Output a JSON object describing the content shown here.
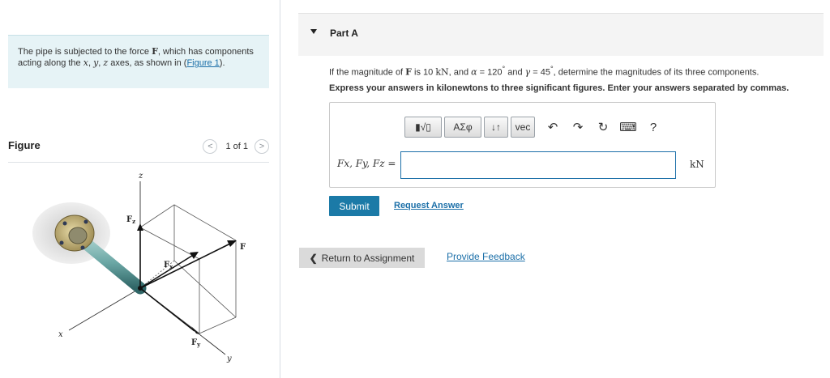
{
  "problem": {
    "text_before_F": "The pipe is subjected to the force ",
    "force_symbol": "F",
    "text_mid_1": ", which has components acting along the ",
    "axis_x": "x",
    "sep_1": ", ",
    "axis_y": "y",
    "sep_2": ", ",
    "axis_z": "z",
    "text_mid_2": " axes, as shown in (",
    "figure_link": "Figure 1",
    "text_end": ")."
  },
  "figure": {
    "title": "Figure",
    "pager_text": "1 of 1",
    "prev_icon": "chevron-left-icon",
    "next_icon": "chevron-right-icon",
    "labels": {
      "z": "z",
      "x": "x",
      "y": "y",
      "Fz": "F",
      "Fz_sub": "z",
      "Fx": "F",
      "Fx_sub": "x",
      "Fy": "F",
      "Fy_sub": "y",
      "F": "F"
    }
  },
  "part": {
    "title": "Part A",
    "caret_icon": "caret-down-icon",
    "q1": {
      "t1": "If the magnitude of ",
      "F": "F",
      "t2": " is 10 ",
      "unit": "kN",
      "t3": ", and ",
      "alpha": "α",
      "t4": " = 120",
      "deg1": "°",
      "t5": " and ",
      "gamma": "γ",
      "t6": " = 45",
      "deg2": "°",
      "t7": ", determine the magnitudes of its three components."
    },
    "q2": "Express your answers in kilonewtons to three significant figures. Enter your answers separated by commas."
  },
  "answer": {
    "toolbar": {
      "templates_label": "▮√▯",
      "greek_label": "ΑΣφ",
      "updown_label": "↓↑",
      "vec_label": "vec",
      "undo_icon": "undo-icon",
      "redo_icon": "redo-icon",
      "reset_icon": "reset-icon",
      "keyboard_icon": "keyboard-icon",
      "help_label": "?"
    },
    "label": "Fx, Fy, Fz =",
    "input_value": "",
    "unit": "kN"
  },
  "buttons": {
    "submit": "Submit",
    "request_answer": "Request Answer",
    "return": "Return to Assignment",
    "return_icon": "chevron-left-icon",
    "feedback": "Provide Feedback"
  }
}
